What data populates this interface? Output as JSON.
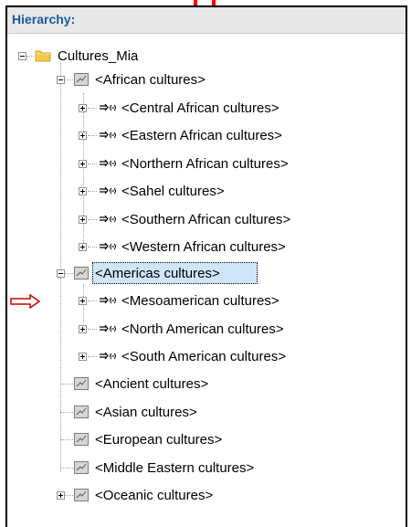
{
  "panel": {
    "title": "Hierarchy:"
  },
  "tree": {
    "root": "Cultures_Mia",
    "african": "<African cultures>",
    "central_african": "<Central African cultures>",
    "eastern_african": "<Eastern African cultures>",
    "northern_african": "<Northern African cultures>",
    "sahel": "<Sahel cultures>",
    "southern_african": "<Southern African cultures>",
    "western_african": "<Western African cultures>",
    "americas": "<Americas cultures>",
    "mesoamerican": "<Mesoamerican cultures>",
    "north_american": "<North American cultures>",
    "south_american": "<South American cultures>",
    "ancient": "<Ancient cultures>",
    "asian": "<Asian cultures>",
    "european": "<European cultures>",
    "middle_eastern": "<Middle Eastern cultures>",
    "oceanic": "<Oceanic cultures>"
  },
  "colors": {
    "title": "#1a5aa3",
    "selection": "#cfe6fa",
    "arrow": "#cc0000",
    "folder": "#f2c94c"
  },
  "icons": {
    "folder": "folder-icon",
    "category": "chart-icon",
    "link": "link-icon",
    "pointer": "arrow-icon"
  }
}
